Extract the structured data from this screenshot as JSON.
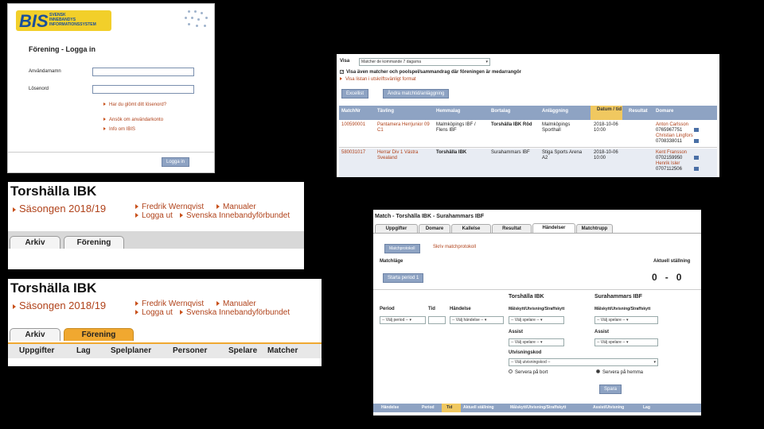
{
  "login": {
    "logo_text": "BIS",
    "logo_sub": [
      "SVENSK",
      "INNEBANDYS",
      "INFORMATIONSSYSTEM"
    ],
    "title": "Förening - Logga in",
    "username_label": "Användarnamn",
    "password_label": "Lösenord",
    "links": [
      "Har du glömt ditt lösenord?",
      "Ansök om användarkonto",
      "Info om IBIS"
    ],
    "login_button": "Logga in"
  },
  "matches": {
    "show_label": "Visa",
    "show_select": "Matcher de kommande 7 dagarna",
    "checkbox1": "Visa även matcher och poolspel/sammandrag där föreningen är medarrangör",
    "link_print": "Visa listan i utskriftsvänligt format",
    "btn_excel": "Excellist",
    "btn_change": "Ändra matchtid/anläggning",
    "columns": [
      "MatchNr",
      "Tävling",
      "Hemmalag",
      "Bortalag",
      "Anläggning",
      "Datum / tid",
      "Resultat",
      "Domare"
    ],
    "rows": [
      {
        "nr": "100590001",
        "comp": "Pantamera Herrjunior 09 C1",
        "home": "Malmköpings IBF / Flens IBF",
        "away": "Torshälla IBK Röd",
        "venue": "Malmköpings Sporthall",
        "date": "2018-10-06",
        "time": "10:00",
        "ref1": "Anton Carlsson",
        "ref1tel": "0765967751",
        "ref2": "Christian Lingfors",
        "ref2tel": "0708338011"
      },
      {
        "nr": "580031017",
        "comp": "Herrar Div 1 Västra Svealand",
        "home": "Torshälla IBK",
        "away": "Surahammars IBF",
        "venue": "Stiga Sports Arena A2",
        "date": "2018-10-06",
        "time": "10:00",
        "ref1": "Kent Fransson",
        "ref1tel": "0702159950",
        "ref2": "Henrik Isler",
        "ref2tel": "0707112506"
      }
    ]
  },
  "club_a": {
    "name": "Torshälla IBK",
    "season": "Säsongen 2018/19",
    "user": "Fredrik Wernqvist",
    "manual": "Manualer",
    "logout": "Logga ut",
    "federation": "Svenska Innebandyförbundet",
    "tabs": [
      "Arkiv",
      "Förening"
    ]
  },
  "club_b": {
    "name": "Torshälla IBK",
    "season": "Säsongen 2018/19",
    "user": "Fredrik Wernqvist",
    "manual": "Manualer",
    "logout": "Logga ut",
    "federation": "Svenska Innebandyförbundet",
    "tabs": [
      "Arkiv",
      "Förening"
    ],
    "subnav": [
      "Uppgifter",
      "Lag",
      "Spelplaner",
      "Personer",
      "Spelare",
      "Matcher"
    ]
  },
  "match": {
    "title": "Match - Torshälla IBK - Surahammars IBF",
    "tabs": [
      "Uppgifter",
      "Domare",
      "Kallelse",
      "Resultat",
      "Händelser",
      "Matchtrupp"
    ],
    "subtab_active": "Matchprotokoll",
    "subtab_link": "Skriv matchprotokoll",
    "matchlage": "Matchläge",
    "current": "Aktuell ställning",
    "score_home": "0",
    "score_sep": "-",
    "score_away": "0",
    "start_btn": "Starta period 1",
    "home_team": "Torshälla IBK",
    "away_team": "Surahammars IBF",
    "col_period": "Period",
    "col_tid": "Tid",
    "col_handelse": "Händelse",
    "col_goal": "Målskytt/Utvisning/Straffskytt",
    "sel_period": "-- Välj period --",
    "sel_handelse": "-- Välj händelse --",
    "sel_player": "-- Välj spelare --",
    "assist": "Assist",
    "utv_kod": "Utvisningskod",
    "sel_utv": "-- Välj utvisningskod --",
    "radio_home": "Servera på bort",
    "radio_away": "Servera på hemma",
    "save": "Spara",
    "footer": [
      "Händelse",
      "Period",
      "Tid",
      "Aktuell ställning",
      "Målskytt/Utvisning/Straffskytt",
      "Assist/Utvisning",
      "Lag"
    ]
  },
  "colors": {
    "accent": "#b0421a",
    "header_blue": "#8ea3c3",
    "tab_orange": "#f0a830",
    "logo_yellow": "#f2cf2a"
  }
}
